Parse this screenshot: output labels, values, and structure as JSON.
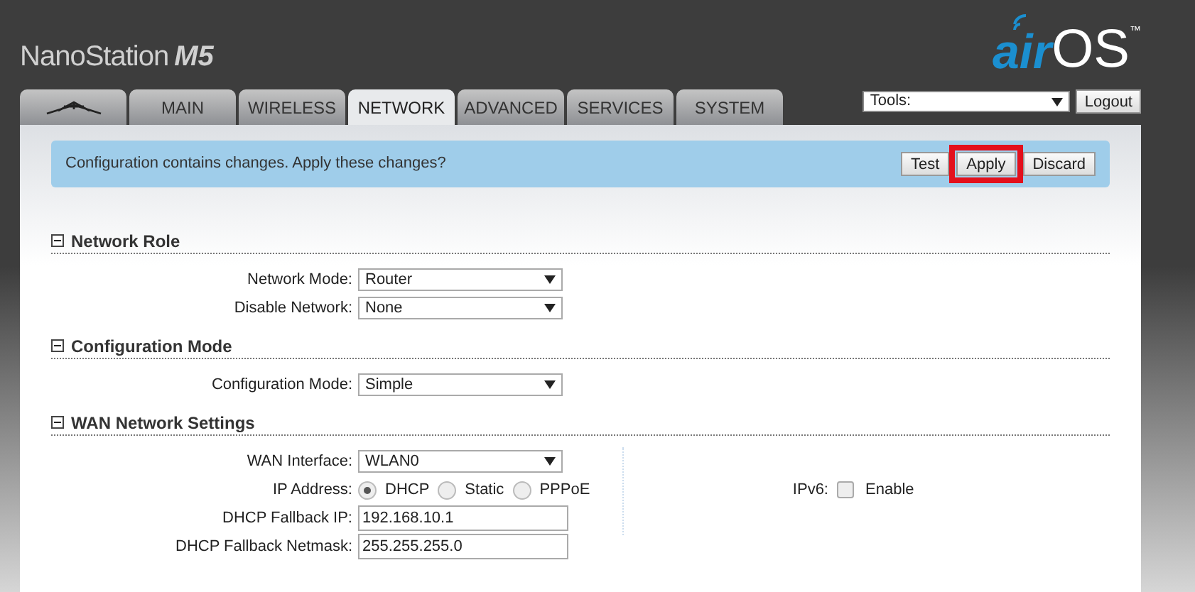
{
  "header": {
    "product": "NanoStation",
    "model": "M5",
    "logo": {
      "part_1": "air",
      "part_2": "OS",
      "trademark": "™"
    }
  },
  "tabs": [
    {
      "kind": "logo",
      "selected": false
    },
    {
      "label": "MAIN",
      "selected": false
    },
    {
      "label": "WIRELESS",
      "selected": false
    },
    {
      "label": "NETWORK",
      "selected": true
    },
    {
      "label": "ADVANCED",
      "selected": false
    },
    {
      "label": "SERVICES",
      "selected": false
    },
    {
      "label": "SYSTEM",
      "selected": false
    }
  ],
  "tools": {
    "value": "Tools:",
    "button": "Logout"
  },
  "banner": {
    "message": "Configuration contains changes. Apply these changes?",
    "buttons": [
      {
        "label": "Test",
        "highlighted": false
      },
      {
        "label": "Apply",
        "highlighted": true
      },
      {
        "label": "Discard",
        "highlighted": false
      }
    ]
  },
  "sections": [
    {
      "title": "Network Role",
      "expanded": true,
      "rows": [
        {
          "kind": "select",
          "label": "Network Mode:",
          "value": "Router"
        },
        {
          "kind": "select",
          "label": "Disable Network:",
          "value": "None"
        }
      ]
    },
    {
      "title": "Configuration Mode",
      "expanded": true,
      "rows": [
        {
          "kind": "select",
          "label": "Configuration Mode:",
          "value": "Simple"
        }
      ]
    },
    {
      "title": "WAN Network Settings",
      "expanded": true,
      "rows": [
        {
          "kind": "select",
          "label": "WAN Interface:",
          "value": "WLAN0"
        },
        {
          "kind": "radio",
          "label": "IP Address:",
          "options": [
            {
              "label": "DHCP",
              "selected": true
            },
            {
              "label": "Static",
              "selected": false
            },
            {
              "label": "PPPoE",
              "selected": false
            }
          ]
        },
        {
          "kind": "text",
          "label": "DHCP Fallback IP:",
          "value": "192.168.10.1"
        },
        {
          "kind": "text",
          "label": "DHCP Fallback Netmask:",
          "value": "255.255.255.0"
        }
      ],
      "side": {
        "label": "IPv6:",
        "checkbox": {
          "label": "Enable",
          "checked": false
        }
      }
    }
  ]
}
